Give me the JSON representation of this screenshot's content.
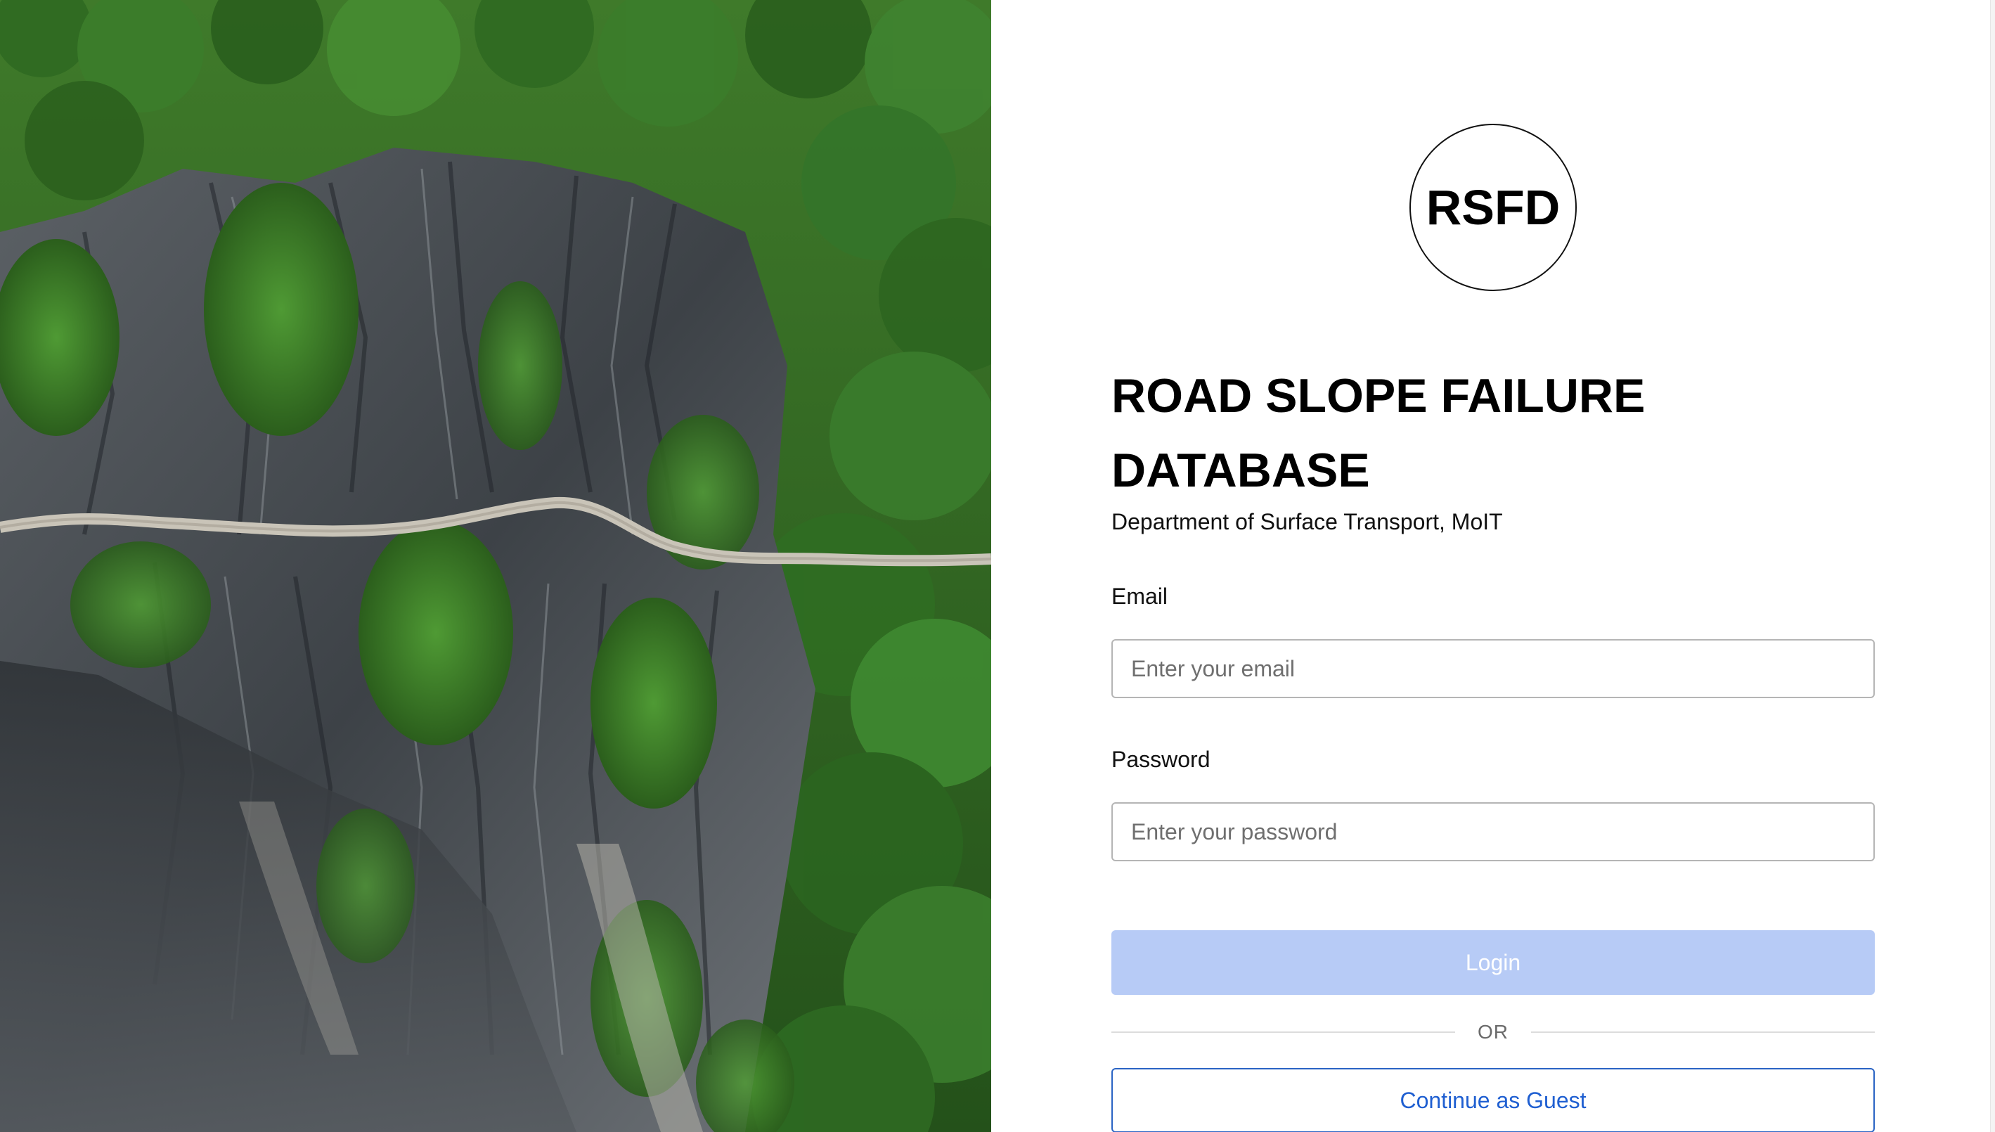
{
  "hero": {
    "image_name": "aerial-landslide-road-photo"
  },
  "logo": {
    "text": "RSFD"
  },
  "header": {
    "title": "ROAD SLOPE FAILURE DATABASE",
    "subtitle": "Department of Surface Transport, MoIT"
  },
  "form": {
    "email": {
      "label": "Email",
      "placeholder": "Enter your email",
      "value": ""
    },
    "password": {
      "label": "Password",
      "placeholder": "Enter your password",
      "value": ""
    },
    "login_label": "Login",
    "divider_label": "OR",
    "guest_label": "Continue as Guest"
  },
  "colors": {
    "login_disabled_bg": "#b7cbf6",
    "guest_accent": "#1f5fd1",
    "forest_green": "#2f6b22",
    "rock_gray": "#4a4f55"
  }
}
